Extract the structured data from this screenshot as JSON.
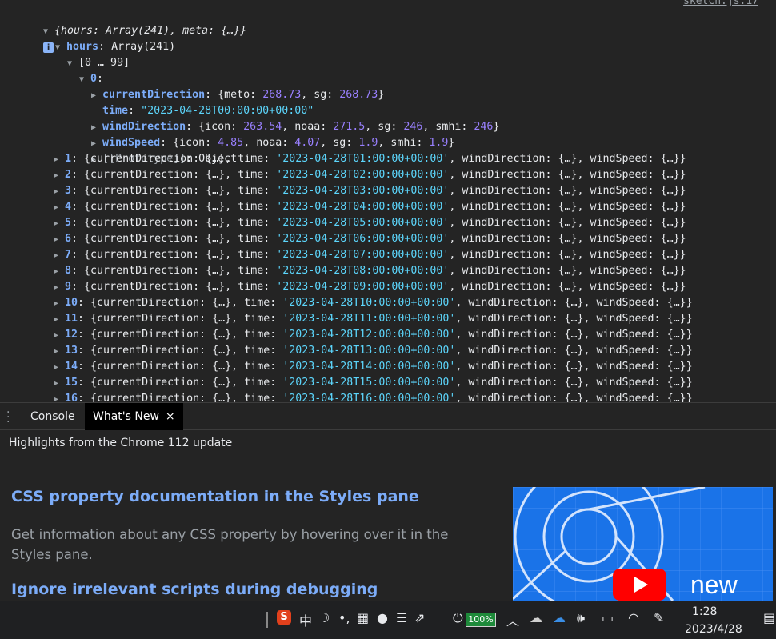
{
  "console": {
    "source_link": "sketch.js:17",
    "root_summary": "{hours: Array(241), meta: {…}}",
    "info_badge": "i",
    "hours_key": "hours",
    "hours_value": "Array(241)",
    "range": "[0 … 99]",
    "item0_key": "0",
    "item0": {
      "currentDirection": {
        "key": "currentDirection",
        "meto": "268.73",
        "sg": "268.73"
      },
      "time": {
        "key": "time",
        "value": "\"2023-04-28T00:00:00+00:00\""
      },
      "windDirection": {
        "key": "windDirection",
        "icon": "263.54",
        "noaa": "271.5",
        "sg": "246",
        "smhi": "246"
      },
      "windSpeed": {
        "key": "windSpeed",
        "icon": "4.85",
        "noaa": "4.07",
        "sg": "1.9",
        "smhi": "1.9"
      },
      "prototype": {
        "key": "[[Prototype]]",
        "value": "Object"
      }
    },
    "rows": [
      {
        "index": "1",
        "time": "'2023-04-28T01:00:00+00:00'"
      },
      {
        "index": "2",
        "time": "'2023-04-28T02:00:00+00:00'"
      },
      {
        "index": "3",
        "time": "'2023-04-28T03:00:00+00:00'"
      },
      {
        "index": "4",
        "time": "'2023-04-28T04:00:00+00:00'"
      },
      {
        "index": "5",
        "time": "'2023-04-28T05:00:00+00:00'"
      },
      {
        "index": "6",
        "time": "'2023-04-28T06:00:00+00:00'"
      },
      {
        "index": "7",
        "time": "'2023-04-28T07:00:00+00:00'"
      },
      {
        "index": "8",
        "time": "'2023-04-28T08:00:00+00:00'"
      },
      {
        "index": "9",
        "time": "'2023-04-28T09:00:00+00:00'"
      },
      {
        "index": "10",
        "time": "'2023-04-28T10:00:00+00:00'"
      },
      {
        "index": "11",
        "time": "'2023-04-28T11:00:00+00:00'"
      },
      {
        "index": "12",
        "time": "'2023-04-28T12:00:00+00:00'"
      },
      {
        "index": "13",
        "time": "'2023-04-28T13:00:00+00:00'"
      },
      {
        "index": "14",
        "time": "'2023-04-28T14:00:00+00:00'"
      },
      {
        "index": "15",
        "time": "'2023-04-28T15:00:00+00:00'"
      },
      {
        "index": "16",
        "time": "'2023-04-28T16:00:00+00:00'"
      }
    ],
    "row_labels": {
      "currentDirection": "currentDirection",
      "time": "time",
      "windDirection": "windDirection",
      "windSpeed": "windSpeed",
      "collapsed": "{…}"
    }
  },
  "drawer": {
    "tabs": [
      {
        "label": "Console"
      },
      {
        "label": "What's New"
      }
    ],
    "close_glyph": "×"
  },
  "whats_new": {
    "header": "Highlights from the Chrome 112 update",
    "sections": [
      {
        "heading": "CSS property documentation in the Styles pane",
        "body": "Get information about any CSS property by hovering over it in the Styles pane."
      },
      {
        "heading": "Ignore irrelevant scripts during debugging"
      }
    ],
    "thumbnail_caption": "new"
  },
  "taskbar": {
    "ime_mode": "中",
    "battery": "100%",
    "time": "1:28",
    "date": "2023/4/28",
    "icons": [
      "sogou-icon",
      "moon-icon",
      "dots-icon",
      "keyboard-icon",
      "user-icon",
      "menu-icon",
      "external-icon",
      "power-plug-icon",
      "chevron-up-icon",
      "cloud-icon",
      "onedrive-icon",
      "volume-icon",
      "battery-tray-icon",
      "wifi-icon",
      "pen-icon",
      "notification-icon"
    ]
  },
  "colors": {
    "key": "#5db0d7",
    "number": "#9980ff",
    "string": "#5cd5fb",
    "link_heading": "#7cacf8",
    "background": "#242424"
  }
}
